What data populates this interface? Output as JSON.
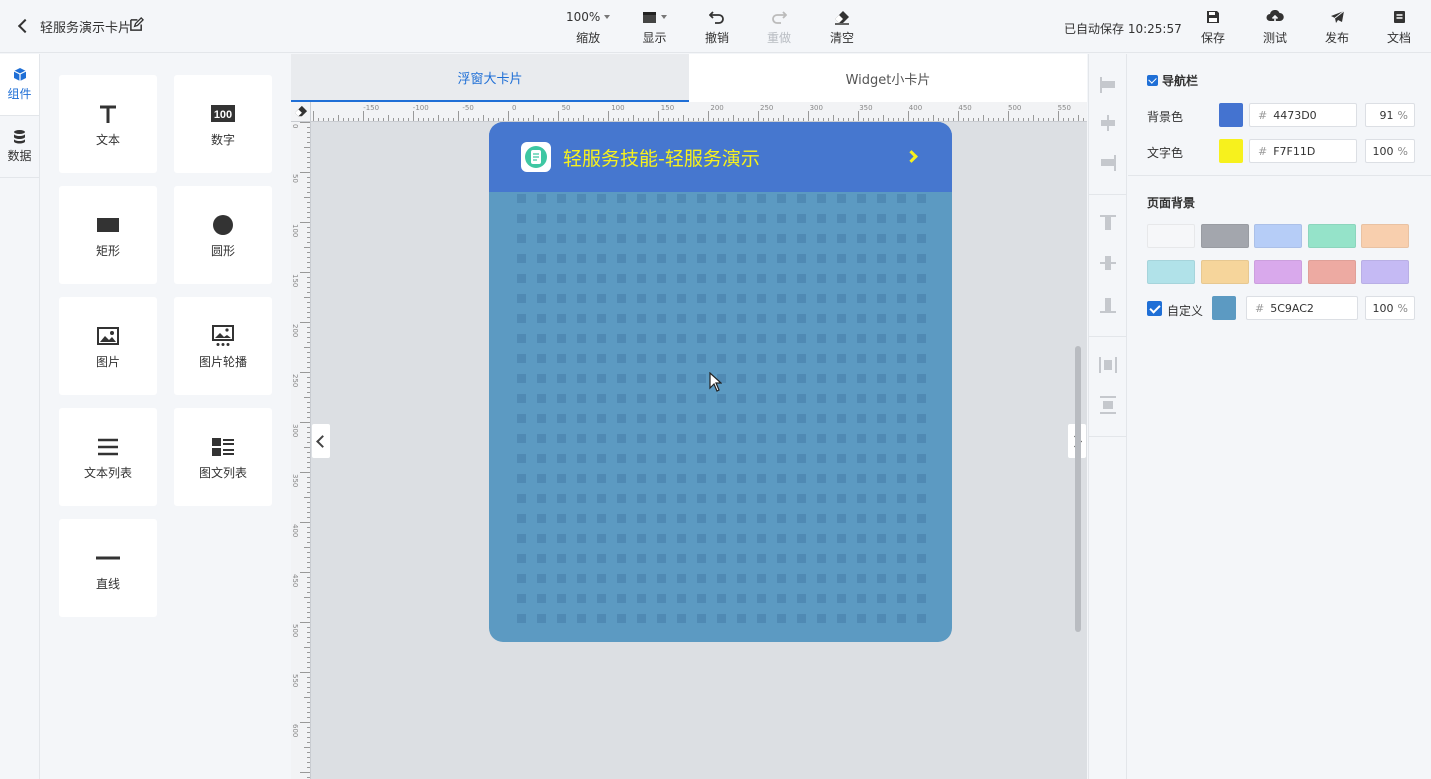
{
  "header": {
    "project_title": "轻服务演示卡片",
    "zoom_value": "100%",
    "zoom_label": "缩放",
    "display_label": "显示",
    "undo_label": "撤销",
    "redo_label": "重做",
    "clear_label": "清空",
    "autosave_text": "已自动保存 10:25:57",
    "save_label": "保存",
    "test_label": "测试",
    "publish_label": "发布",
    "docs_label": "文档"
  },
  "rail": {
    "components_label": "组件",
    "data_label": "数据"
  },
  "components": [
    {
      "label": "文本",
      "icon": "text-icon"
    },
    {
      "label": "数字",
      "icon": "number-icon",
      "icon_text": "100"
    },
    {
      "label": "矩形",
      "icon": "rectangle-icon"
    },
    {
      "label": "圆形",
      "icon": "circle-icon"
    },
    {
      "label": "图片",
      "icon": "image-icon"
    },
    {
      "label": "图片轮播",
      "icon": "carousel-icon"
    },
    {
      "label": "文本列表",
      "icon": "text-list-icon"
    },
    {
      "label": "图文列表",
      "icon": "image-text-list-icon"
    },
    {
      "label": "直线",
      "icon": "line-icon"
    }
  ],
  "canvas": {
    "tab_large": "浮窗大卡片",
    "tab_small": "Widget小卡片",
    "ruler_top": [
      "-150",
      "-100",
      "-50",
      "0",
      "50",
      "100",
      "150",
      "200",
      "250",
      "300",
      "350",
      "400",
      "450",
      "500",
      "550"
    ],
    "ruler_left": [
      "0",
      "50",
      "100",
      "150",
      "200",
      "250",
      "300",
      "350",
      "400",
      "450",
      "500",
      "550",
      "600"
    ],
    "card_title": "轻服务技能-轻服务演示"
  },
  "props": {
    "navbar_label": "导航栏",
    "bg_color_label": "背景色",
    "bg_color_hex": "4473D0",
    "bg_color_swatch": "#4473D0",
    "bg_opacity": "91",
    "text_color_label": "文字色",
    "text_color_hex": "F7F11D",
    "text_color_swatch": "#F7F11D",
    "text_opacity": "100",
    "page_bg_label": "页面背景",
    "page_bg_swatches": [
      "#f6f7f9",
      "#a3a6ad",
      "#b6cdf7",
      "#95e3c9",
      "#f8cfae",
      "#b1e2e9",
      "#f6d59b",
      "#d9a9ec",
      "#edaaa2",
      "#c5baf4"
    ],
    "custom_label": "自定义",
    "custom_hex": "5C9AC2",
    "custom_swatch": "#5C9AC2",
    "custom_opacity": "100",
    "percent": "%",
    "hash": "#"
  }
}
